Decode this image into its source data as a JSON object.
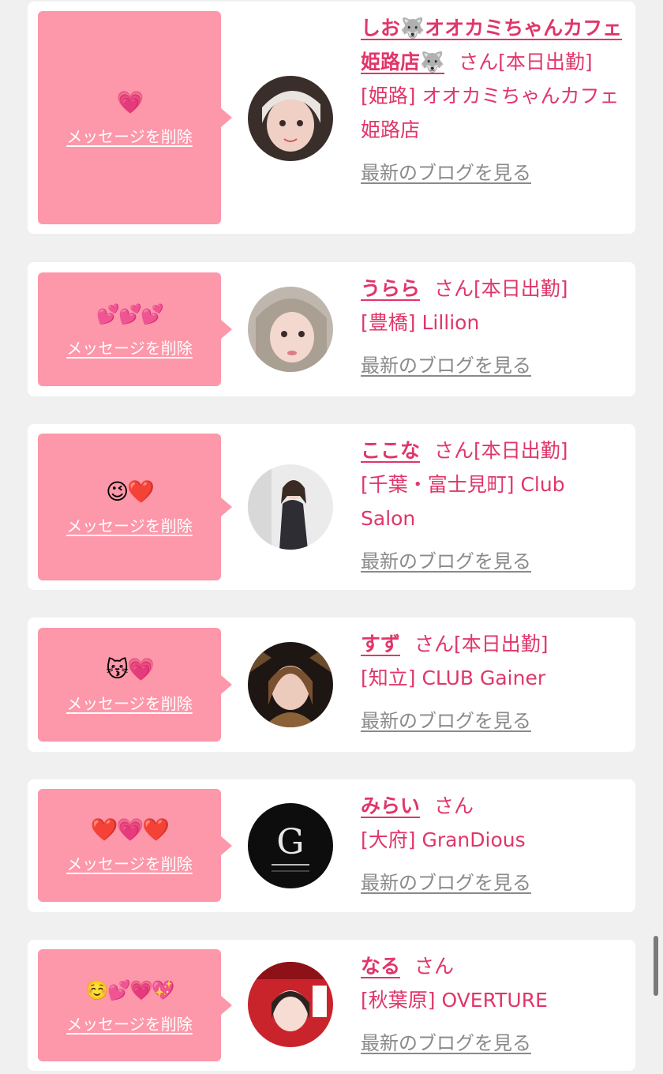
{
  "ui": {
    "delete_label": "メッセージを削除",
    "blog_label": "最新のブログを見る",
    "honorific": "さん"
  },
  "entries": [
    {
      "emoji": "💗",
      "name": "しお🐺オオカミちゃんカフェ姫路店🐺",
      "status": "[本日出勤]",
      "shop": "[姫路] オオカミちゃんカフェ姫路店"
    },
    {
      "emoji": "💕💕💕",
      "name": "うらら",
      "status": "[本日出勤]",
      "shop": "[豊橋] Lillion"
    },
    {
      "emoji": "😉❤️",
      "name": "ここな",
      "status": "[本日出勤]",
      "shop": "[千葉・富士見町] Club Salon"
    },
    {
      "emoji": "😽💗",
      "name": "すず",
      "status": "[本日出勤]",
      "shop": "[知立] CLUB Gainer"
    },
    {
      "emoji": "❤️💗❤️",
      "name": "みらい",
      "status": "",
      "shop": "[大府] GranDious"
    },
    {
      "emoji": "☺️💕💗💖",
      "name": "なる",
      "status": "",
      "shop": "[秋葉原] OVERTURE"
    }
  ]
}
